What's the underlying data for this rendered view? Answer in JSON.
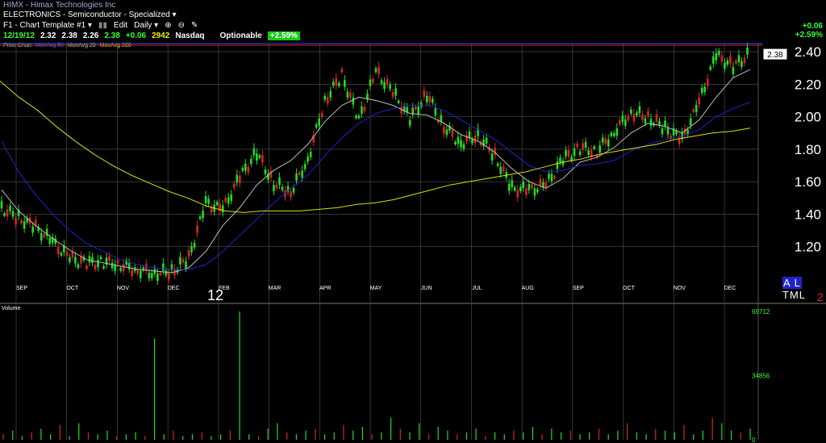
{
  "header": {
    "title": "HIMX - Himax Technologies Inc",
    "sector": "ELECTRONICS - Semiconductor - Specialized",
    "toolbar": {
      "template": "F1 - Chart Template #1",
      "edit": "Edit",
      "period": "Daily"
    },
    "quote": {
      "date": "12/19/12",
      "open": "2.32",
      "high": "2.38",
      "low": "2.26",
      "close": "2.38",
      "change": "+0.06",
      "volume": "2942",
      "exchange": "Nasdaq",
      "optionable": "Optionable",
      "pct_badge": "+2.59%"
    },
    "legend": {
      "price": "Price Chart",
      "ma1": "MovAvg 50",
      "ma2": "MovAvg 20",
      "ma3": "MovAvg 200"
    },
    "right_change": "+0.06",
    "right_pct": "+2.59%"
  },
  "labels": {
    "big_twelve": "12",
    "atl": "TML",
    "atl_a": "A L",
    "red_two": "2",
    "volume": "Volume"
  },
  "colors": {
    "up": "#22dd22",
    "down": "#dd2222",
    "ma50": "#2222cc",
    "ma20": "#bbbbbb",
    "ma200": "#dddd00",
    "grid": "#555555",
    "resistance": "#cc2222"
  },
  "chart_data": {
    "type": "line",
    "title": "HIMX - Himax Technologies Inc",
    "ylabel": "",
    "ylim": [
      1.0,
      2.45
    ],
    "yticks": [
      "2.40",
      "2.20",
      "2.00",
      "1.80",
      "1.60",
      "1.40",
      "1.20"
    ],
    "ytick_values": [
      2.4,
      2.2,
      2.0,
      1.8,
      1.6,
      1.4,
      1.2
    ],
    "xticks": [
      "SEP",
      "OCT",
      "NOV",
      "DEC",
      "FEB",
      "MAR",
      "APR",
      "MAY",
      "JUN",
      "JUL",
      "AUG",
      "SEP",
      "OCT",
      "NOV",
      "DEC"
    ],
    "last_price_label": "2.38",
    "resistance_level": 2.44,
    "series": [
      {
        "name": "Price Chart",
        "values": [
          1.43,
          1.37,
          1.31,
          1.22,
          1.12,
          1.09,
          1.1,
          1.08,
          1.05,
          1.03,
          1.04,
          1.12,
          1.46,
          1.42,
          1.62,
          1.77,
          1.58,
          1.53,
          1.73,
          2.09,
          2.25,
          1.97,
          2.27,
          2.14,
          1.98,
          2.13,
          1.93,
          1.83,
          1.88,
          1.75,
          1.55,
          1.54,
          1.57,
          1.73,
          1.8,
          1.78,
          1.9,
          2.02,
          1.99,
          1.92,
          1.85,
          2.08,
          2.37,
          2.3,
          2.38
        ]
      },
      {
        "name": "MovAvg 20",
        "values": [
          1.55,
          1.42,
          1.33,
          1.25,
          1.18,
          1.12,
          1.1,
          1.08,
          1.06,
          1.05,
          1.04,
          1.07,
          1.17,
          1.33,
          1.44,
          1.58,
          1.67,
          1.73,
          1.83,
          1.97,
          2.07,
          2.12,
          2.1,
          2.07,
          2.02,
          2.01,
          1.96,
          1.89,
          1.85,
          1.78,
          1.68,
          1.6,
          1.56,
          1.62,
          1.72,
          1.75,
          1.81,
          1.9,
          1.96,
          1.94,
          1.9,
          1.98,
          2.12,
          2.24,
          2.29
        ]
      },
      {
        "name": "MovAvg 50",
        "values": [
          1.85,
          1.66,
          1.52,
          1.4,
          1.3,
          1.22,
          1.17,
          1.12,
          1.09,
          1.07,
          1.06,
          1.06,
          1.09,
          1.17,
          1.27,
          1.37,
          1.47,
          1.56,
          1.64,
          1.76,
          1.87,
          1.96,
          2.02,
          2.05,
          2.07,
          2.07,
          2.04,
          1.98,
          1.92,
          1.86,
          1.78,
          1.7,
          1.66,
          1.67,
          1.7,
          1.71,
          1.73,
          1.79,
          1.83,
          1.86,
          1.88,
          1.92,
          2.0,
          2.05,
          2.09
        ]
      },
      {
        "name": "MovAvg 200",
        "values": [
          2.22,
          2.12,
          2.04,
          1.94,
          1.85,
          1.77,
          1.7,
          1.64,
          1.59,
          1.54,
          1.5,
          1.45,
          1.42,
          1.41,
          1.42,
          1.42,
          1.42,
          1.43,
          1.44,
          1.46,
          1.47,
          1.49,
          1.52,
          1.55,
          1.58,
          1.6,
          1.62,
          1.64,
          1.66,
          1.69,
          1.72,
          1.74,
          1.77,
          1.79,
          1.81,
          1.83,
          1.86,
          1.88,
          1.9,
          1.91,
          1.93
        ]
      }
    ],
    "volume": {
      "ylabel": "Volume",
      "yticks": [
        "69712",
        "34856",
        "0"
      ],
      "ytick_values": [
        69712,
        34856,
        0
      ],
      "values": [
        3000,
        5000,
        2000,
        4000,
        6000,
        3000,
        8000,
        2000,
        9000,
        4000,
        3000,
        5000,
        2000,
        3000,
        4000,
        2000,
        55000,
        3000,
        5000,
        2000,
        3000,
        4000,
        2000,
        3000,
        5000,
        69712,
        3000,
        2000,
        6000,
        9000,
        4000,
        3000,
        5000,
        6000,
        3000,
        4000,
        8000,
        5000,
        7000,
        3000,
        4000,
        12000,
        6000,
        4000,
        9000,
        3000,
        7000,
        5000,
        3000,
        4000,
        6000,
        2000,
        4000,
        3000,
        5000,
        4000,
        7000,
        3000,
        6000,
        4000,
        5000,
        3000,
        4000,
        6000,
        3000,
        5000,
        9000,
        4000,
        3000,
        6000,
        5000,
        4000,
        8000,
        3000,
        5000,
        12000,
        9000,
        5000,
        4000,
        6000
      ]
    }
  }
}
